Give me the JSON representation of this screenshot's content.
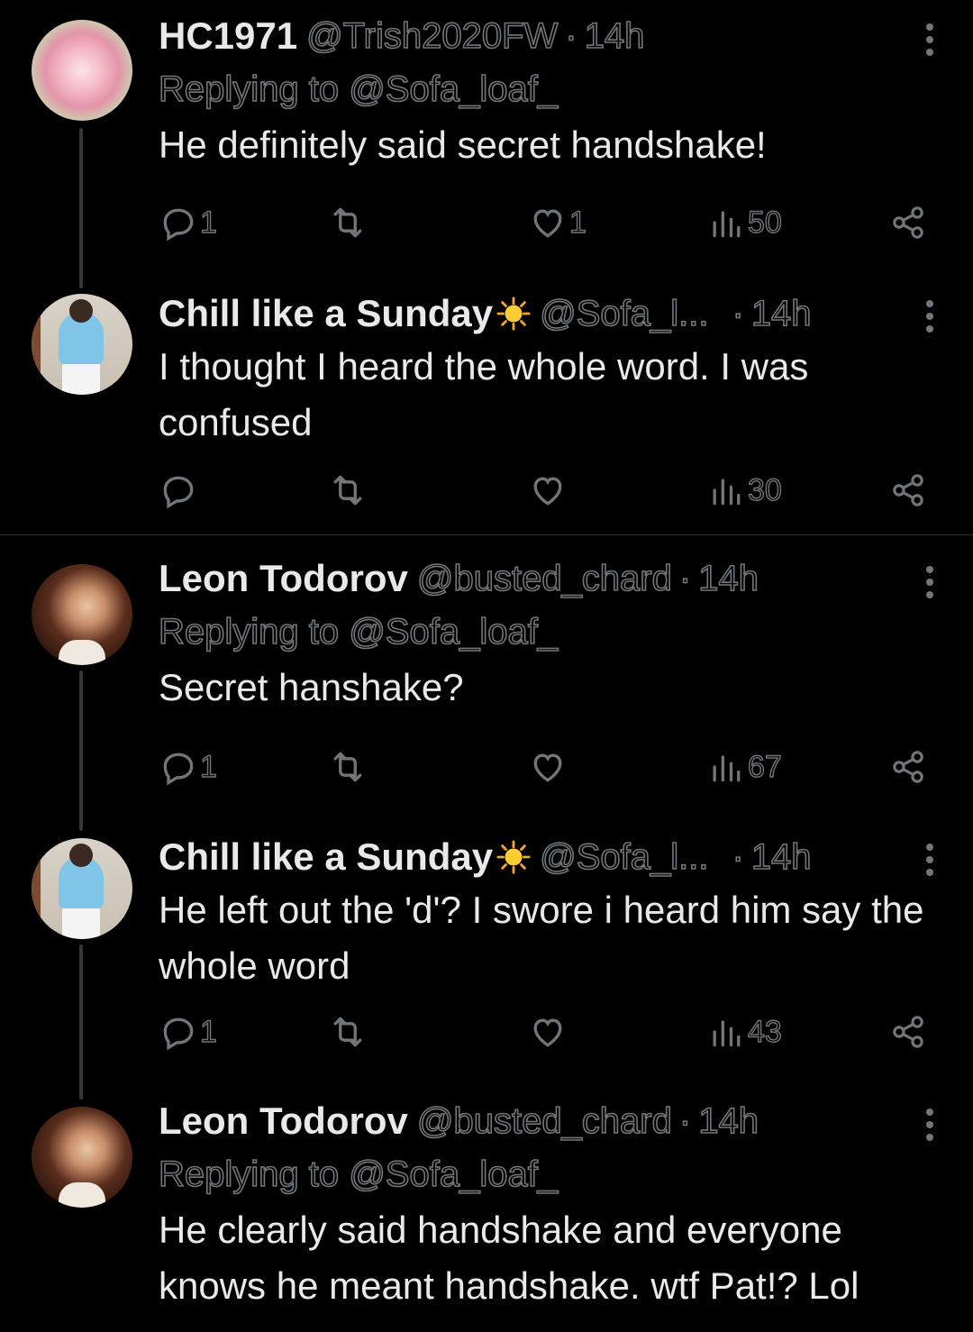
{
  "tweets": [
    {
      "name": "HC1971",
      "handle": "@Trish2020FW",
      "dot": "·",
      "time": "14h",
      "replying": "Replying to @Sofa_loaf_",
      "text": "He definitely said secret handshake!",
      "replies": "1",
      "likes": "1",
      "views": "50",
      "avatar": "flower-avatar"
    },
    {
      "name": "Chill like a Sunday",
      "handle": "@Sofa_l...",
      "dot": "·",
      "time": "14h",
      "text": "I thought I heard the whole word. I was confused",
      "replies": "",
      "likes": "",
      "views": "30",
      "avatar": "sun-emoji"
    },
    {
      "name": "Leon Todorov",
      "handle": "@busted_chard",
      "dot": "·",
      "time": "14h",
      "replying": "Replying to @Sofa_loaf_",
      "text": "Secret hanshake?",
      "replies": "1",
      "likes": "",
      "views": "67",
      "avatar": "portrait-avatar"
    },
    {
      "name": "Chill like a Sunday",
      "handle": "@Sofa_l...",
      "dot": "·",
      "time": "14h",
      "text": "He left out the 'd'? I swore i heard him say the whole word",
      "replies": "1",
      "likes": "",
      "views": "43",
      "avatar": "sun-emoji"
    },
    {
      "name": "Leon Todorov",
      "handle": "@busted_chard",
      "dot": "·",
      "time": "14h",
      "replying": "Replying to @Sofa_loaf_",
      "text": "He clearly said handshake and everyone knows he meant handshake. wtf Pat!? Lol",
      "avatar": "portrait-avatar"
    }
  ],
  "colors": {
    "background": "#000000",
    "primary_text": "#e7e9ea",
    "secondary_text": "#71767b",
    "divider": "#2f3336"
  }
}
